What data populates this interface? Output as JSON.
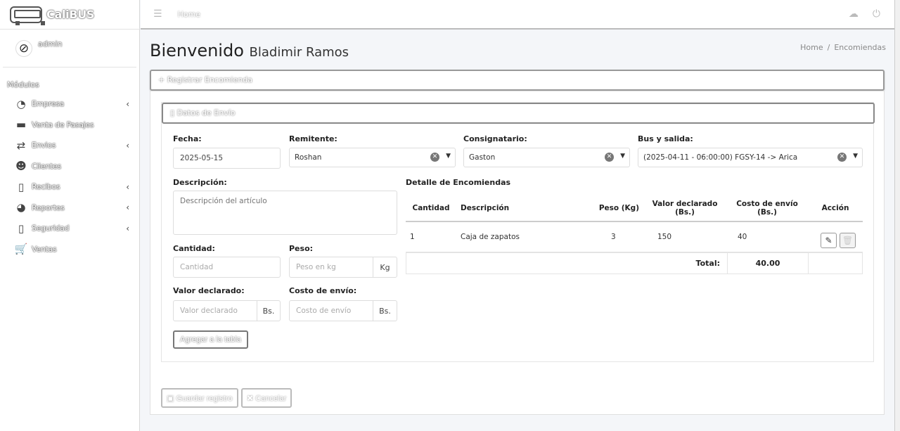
{
  "brand": {
    "name": "CaliBUS",
    "logo_icon": "bus-icon"
  },
  "user": {
    "name": "admin",
    "avatar_icon": "user-avatar-icon"
  },
  "sidebar": {
    "header": "Módulos",
    "items": [
      {
        "label": "Empresa",
        "icon": "dashboard-icon",
        "glyph": "◔",
        "has_caret": true
      },
      {
        "label": "Venta de Pasajes",
        "icon": "ticket-icon",
        "glyph": "▬",
        "has_caret": false
      },
      {
        "label": "Envios",
        "icon": "exchange-icon",
        "glyph": "⇄",
        "has_caret": true
      },
      {
        "label": "Clientes",
        "icon": "users-icon",
        "glyph": "☻",
        "has_caret": false
      },
      {
        "label": "Recibos",
        "icon": "clipboard-icon",
        "glyph": "▯",
        "has_caret": true
      },
      {
        "label": "Reportes",
        "icon": "pie-chart-icon",
        "glyph": "◕",
        "has_caret": true
      },
      {
        "label": "Seguridad",
        "icon": "clipboard-check-icon",
        "glyph": "▯",
        "has_caret": true
      },
      {
        "label": "Ventas",
        "icon": "cart-icon",
        "glyph": "🛒",
        "has_caret": false
      }
    ],
    "caret": "‹"
  },
  "topbar": {
    "home_link": "Home"
  },
  "header": {
    "title": "Bienvenido",
    "subtitle": "Bladimir Ramos",
    "breadcrumb": [
      "Home",
      "Encomiendas"
    ],
    "breadcrumb_sep": "/"
  },
  "register_card": {
    "title": "+ Registrar Encomienda"
  },
  "shipment_card": {
    "title": "Datos de Envío"
  },
  "form": {
    "fecha": {
      "label": "Fecha:",
      "value": "2025-05-15"
    },
    "remitente": {
      "label": "Remitente:",
      "value": "Roshan"
    },
    "consignatario": {
      "label": "Consignatario:",
      "value": "Gaston"
    },
    "bus": {
      "label": "Bus y salida:",
      "value": "(2025-04-11 - 06:00:00) FGSY-14 -> Arica"
    },
    "descripcion": {
      "label": "Descripción:",
      "placeholder": "Descripción del artículo"
    },
    "cantidad": {
      "label": "Cantidad:",
      "placeholder": "Cantidad"
    },
    "peso": {
      "label": "Peso:",
      "placeholder": "Peso en kg",
      "unit": "Kg"
    },
    "valor": {
      "label": "Valor declarado:",
      "placeholder": "Valor declarado",
      "unit": "Bs."
    },
    "costo": {
      "label": "Costo de envío:",
      "placeholder": "Costo de envío",
      "unit": "Bs."
    },
    "add_button": "Agregar a la tabla"
  },
  "detail": {
    "title": "Detalle de Encomiendas",
    "columns": [
      "Cantidad",
      "Descripción",
      "Peso (Kg)",
      "Valor declarado (Bs.)",
      "Costo de envío (Bs.)",
      "Acción"
    ],
    "rows": [
      {
        "cantidad": "1",
        "descripcion": "Caja de zapatos",
        "peso": "3",
        "valor": "150",
        "costo": "40"
      }
    ],
    "total_label": "Total:",
    "total_value": "40.00"
  },
  "footer": {
    "save_label": "Guardar registro",
    "cancel_label": "Cancelar"
  }
}
